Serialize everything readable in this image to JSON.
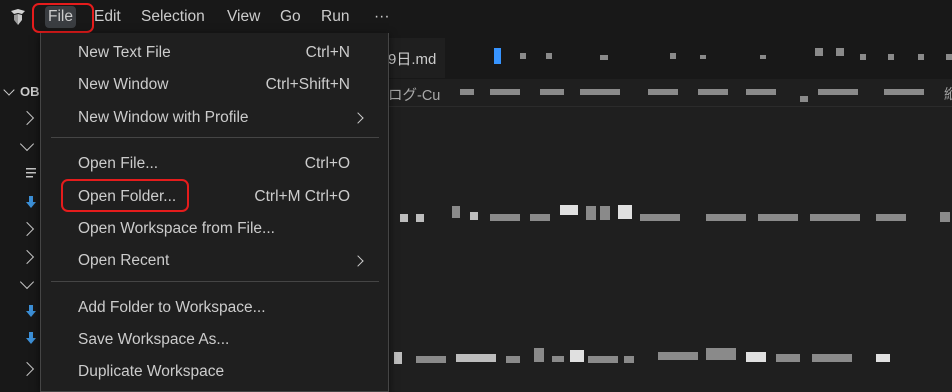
{
  "menubar": {
    "items": [
      {
        "label": "File",
        "active": true
      },
      {
        "label": "Edit"
      },
      {
        "label": "Selection"
      },
      {
        "label": "View"
      },
      {
        "label": "Go"
      },
      {
        "label": "Run"
      },
      {
        "label": "···"
      }
    ]
  },
  "tab": {
    "label": "9日.md"
  },
  "breadcrumb": {
    "label": "ログ-Cu",
    "edge_label": "縦"
  },
  "explorer": {
    "section_label": "OB"
  },
  "file_menu": {
    "groups": [
      [
        {
          "label": "New Text File",
          "shortcut": "Ctrl+N"
        },
        {
          "label": "New Window",
          "shortcut": "Ctrl+Shift+N"
        },
        {
          "label": "New Window with Profile",
          "submenu": true
        }
      ],
      [
        {
          "label": "Open File...",
          "shortcut": "Ctrl+O"
        },
        {
          "label": "Open Folder...",
          "shortcut": "Ctrl+M Ctrl+O",
          "highlighted": true
        },
        {
          "label": "Open Workspace from File..."
        },
        {
          "label": "Open Recent",
          "submenu": true
        }
      ],
      [
        {
          "label": "Add Folder to Workspace..."
        },
        {
          "label": "Save Workspace As..."
        },
        {
          "label": "Duplicate Workspace"
        }
      ]
    ]
  },
  "colors": {
    "background": "#1f1f1f",
    "chrome": "#181818",
    "text": "#cccccc",
    "highlight_outline": "#e51c1c",
    "accent": "#3794ff"
  }
}
